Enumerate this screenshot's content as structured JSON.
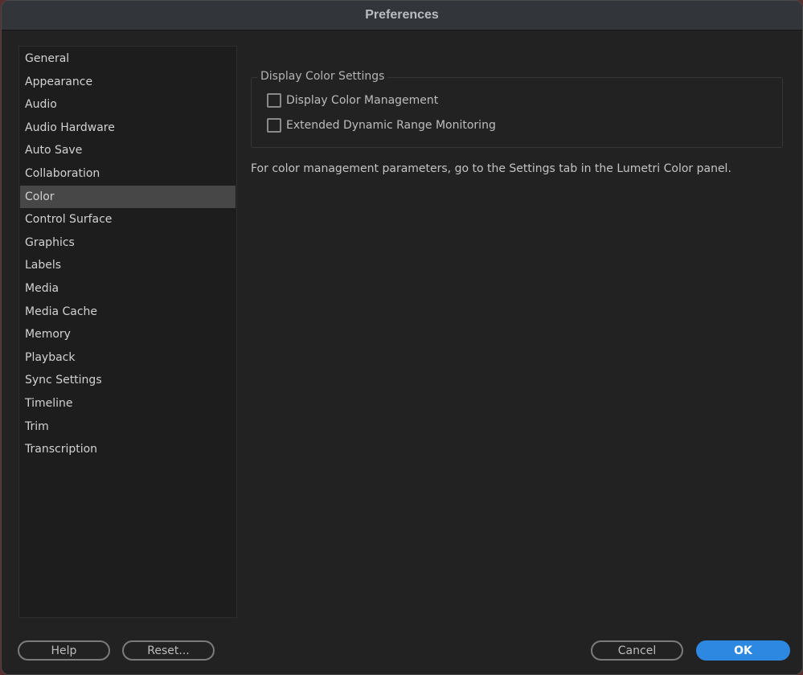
{
  "window": {
    "title": "Preferences"
  },
  "sidebar": {
    "selected": "Color",
    "items": [
      {
        "label": "General"
      },
      {
        "label": "Appearance"
      },
      {
        "label": "Audio"
      },
      {
        "label": "Audio Hardware"
      },
      {
        "label": "Auto Save"
      },
      {
        "label": "Collaboration"
      },
      {
        "label": "Color"
      },
      {
        "label": "Control Surface"
      },
      {
        "label": "Graphics"
      },
      {
        "label": "Labels"
      },
      {
        "label": "Media"
      },
      {
        "label": "Media Cache"
      },
      {
        "label": "Memory"
      },
      {
        "label": "Playback"
      },
      {
        "label": "Sync Settings"
      },
      {
        "label": "Timeline"
      },
      {
        "label": "Trim"
      },
      {
        "label": "Transcription"
      }
    ]
  },
  "main": {
    "group_title": "Display Color Settings",
    "checkboxes": [
      {
        "label": "Display Color Management",
        "checked": false
      },
      {
        "label": "Extended Dynamic Range Monitoring",
        "checked": false
      }
    ],
    "note": "For color management parameters, go to the Settings tab in the Lumetri Color panel."
  },
  "footer": {
    "help_label": "Help",
    "reset_label": "Reset...",
    "cancel_label": "Cancel",
    "ok_label": "OK"
  },
  "colors": {
    "accent": "#2d88e2",
    "selected_item_bg": "#474747"
  }
}
